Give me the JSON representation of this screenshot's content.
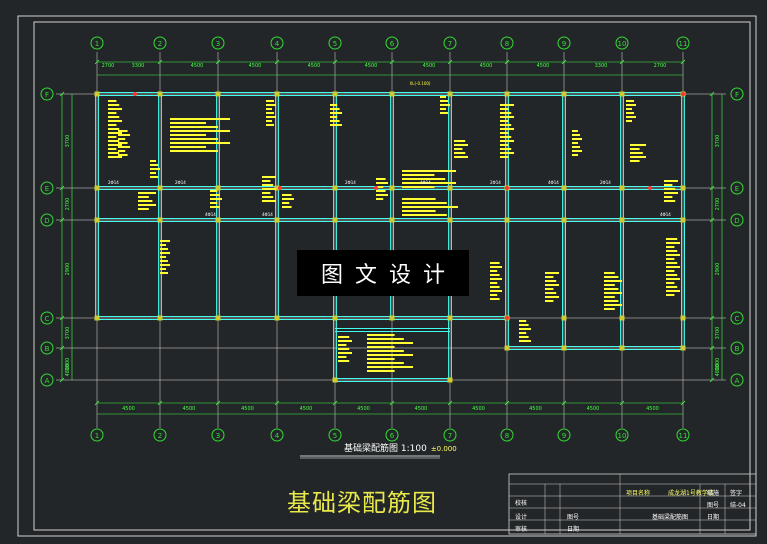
{
  "watermark": "图文设计",
  "drawing": {
    "title": "基础梁配筋图",
    "subtitle": "基础梁配筋图 1:100",
    "scale_note": "±0.000"
  },
  "title_block": {
    "project_label": "项目名称",
    "project_name": "成龙湖1号教学楼",
    "drawing_name": "基础梁配筋图",
    "row_labels": [
      "校核",
      "设计",
      "审核"
    ],
    "col_labels": [
      "图号",
      "日期"
    ],
    "sign_label": "签字",
    "stage_label": "结施",
    "number_label": "图号",
    "number_value": "结-04",
    "date_label": "日期"
  },
  "colors": {
    "background": "#222628",
    "frame": "#d0d0d0",
    "grid_line": "#e0e0e0",
    "axis_bubble": "#33dd33",
    "beam": "#44ffee",
    "rebar_text": "#ffff33",
    "dim": "#44ff44",
    "red_mark": "#ff3333"
  },
  "axes": {
    "columns": [
      "1",
      "2",
      "3",
      "4",
      "5",
      "6",
      "7",
      "8",
      "9",
      "10",
      "11"
    ],
    "rows": [
      "F",
      "E",
      "D",
      "C",
      "B",
      "A"
    ]
  },
  "dims": {
    "top": [
      "2700",
      "3300",
      "4500",
      "4500",
      "4500",
      "4500",
      "4500",
      "4500",
      "4500",
      "3300",
      "2700"
    ],
    "bottom": [
      "4500",
      "4500",
      "4500",
      "4500",
      "4500",
      "4500",
      "4500",
      "4500",
      "4500",
      "4500"
    ],
    "left": [
      "3700",
      "2700",
      "2900",
      "3700",
      "1800",
      "4800"
    ],
    "right": [
      "3700",
      "2700",
      "2900",
      "3700",
      "1800",
      "4800"
    ]
  },
  "beam_labels": [
    "2Φ14",
    "2Φ14",
    "4Φ14",
    "4Φ14",
    "2Φ14",
    "4Φ14",
    "2Φ14",
    "4Φ14",
    "2Φ14",
    "4Φ14"
  ],
  "elev_label": "XL(-0.100)"
}
